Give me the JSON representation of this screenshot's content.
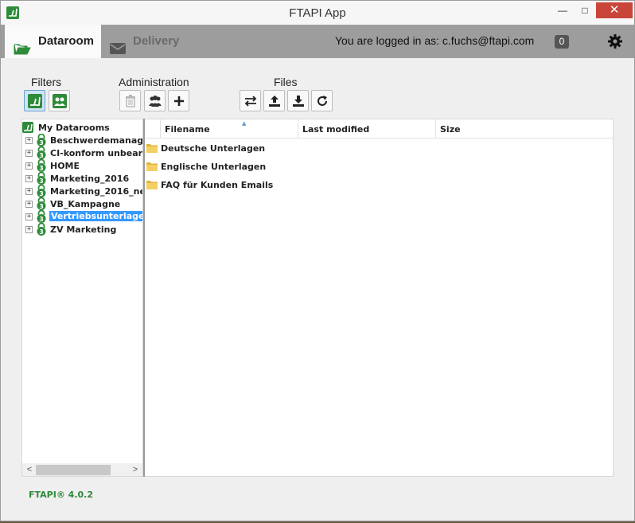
{
  "window": {
    "title": "FTAPI App",
    "minimize": "—",
    "maximize": "□",
    "close": "✕"
  },
  "nav": {
    "tabs": [
      {
        "label": "Dataroom",
        "icon": "folder-open-icon",
        "active": true
      },
      {
        "label": "Delivery",
        "icon": "envelope-icon",
        "active": false
      }
    ],
    "logged_in_text": "You are logged in as: c.fuchs@ftapi.com",
    "notification_count": "0",
    "settings_icon": "gear-icon"
  },
  "toolbar": {
    "filters_label": "Filters",
    "administration_label": "Administration",
    "files_label": "Files",
    "filters_buttons": [
      "ftapi-filter-icon",
      "group-filter-icon"
    ],
    "administration_buttons": [
      "trash-icon",
      "users-icon",
      "plus-icon"
    ],
    "files_buttons": [
      "sync-icon",
      "upload-icon",
      "download-icon",
      "refresh-icon"
    ]
  },
  "tree": {
    "root_label": "My Datarooms",
    "lock_badge": "3",
    "items": [
      {
        "label": "Beschwerdemanage"
      },
      {
        "label": "CI-konform unbearb"
      },
      {
        "label": "HOME"
      },
      {
        "label": "Marketing_2016"
      },
      {
        "label": "Marketing_2016_ne"
      },
      {
        "label": "VB_Kampagne"
      },
      {
        "label": "Vertriebsunterlagen",
        "selected": true
      },
      {
        "label": "ZV Marketing"
      }
    ],
    "scroll_left": "<",
    "scroll_right": ">"
  },
  "files": {
    "columns": [
      "Filename",
      "Last modified",
      "Size"
    ],
    "sort_indicator": "▲",
    "rows": [
      {
        "name": "Deutsche Unterlagen",
        "modified": "",
        "size": ""
      },
      {
        "name": "Englische Unterlagen",
        "modified": "",
        "size": ""
      },
      {
        "name": "FAQ für Kunden Emails",
        "modified": "",
        "size": ""
      }
    ]
  },
  "footer": {
    "version": "FTAPI® 4.0.2"
  },
  "colors": {
    "brand_green": "#2e8b3a",
    "selection_blue": "#3399ff",
    "nav_gray": "#9d9d9d"
  }
}
